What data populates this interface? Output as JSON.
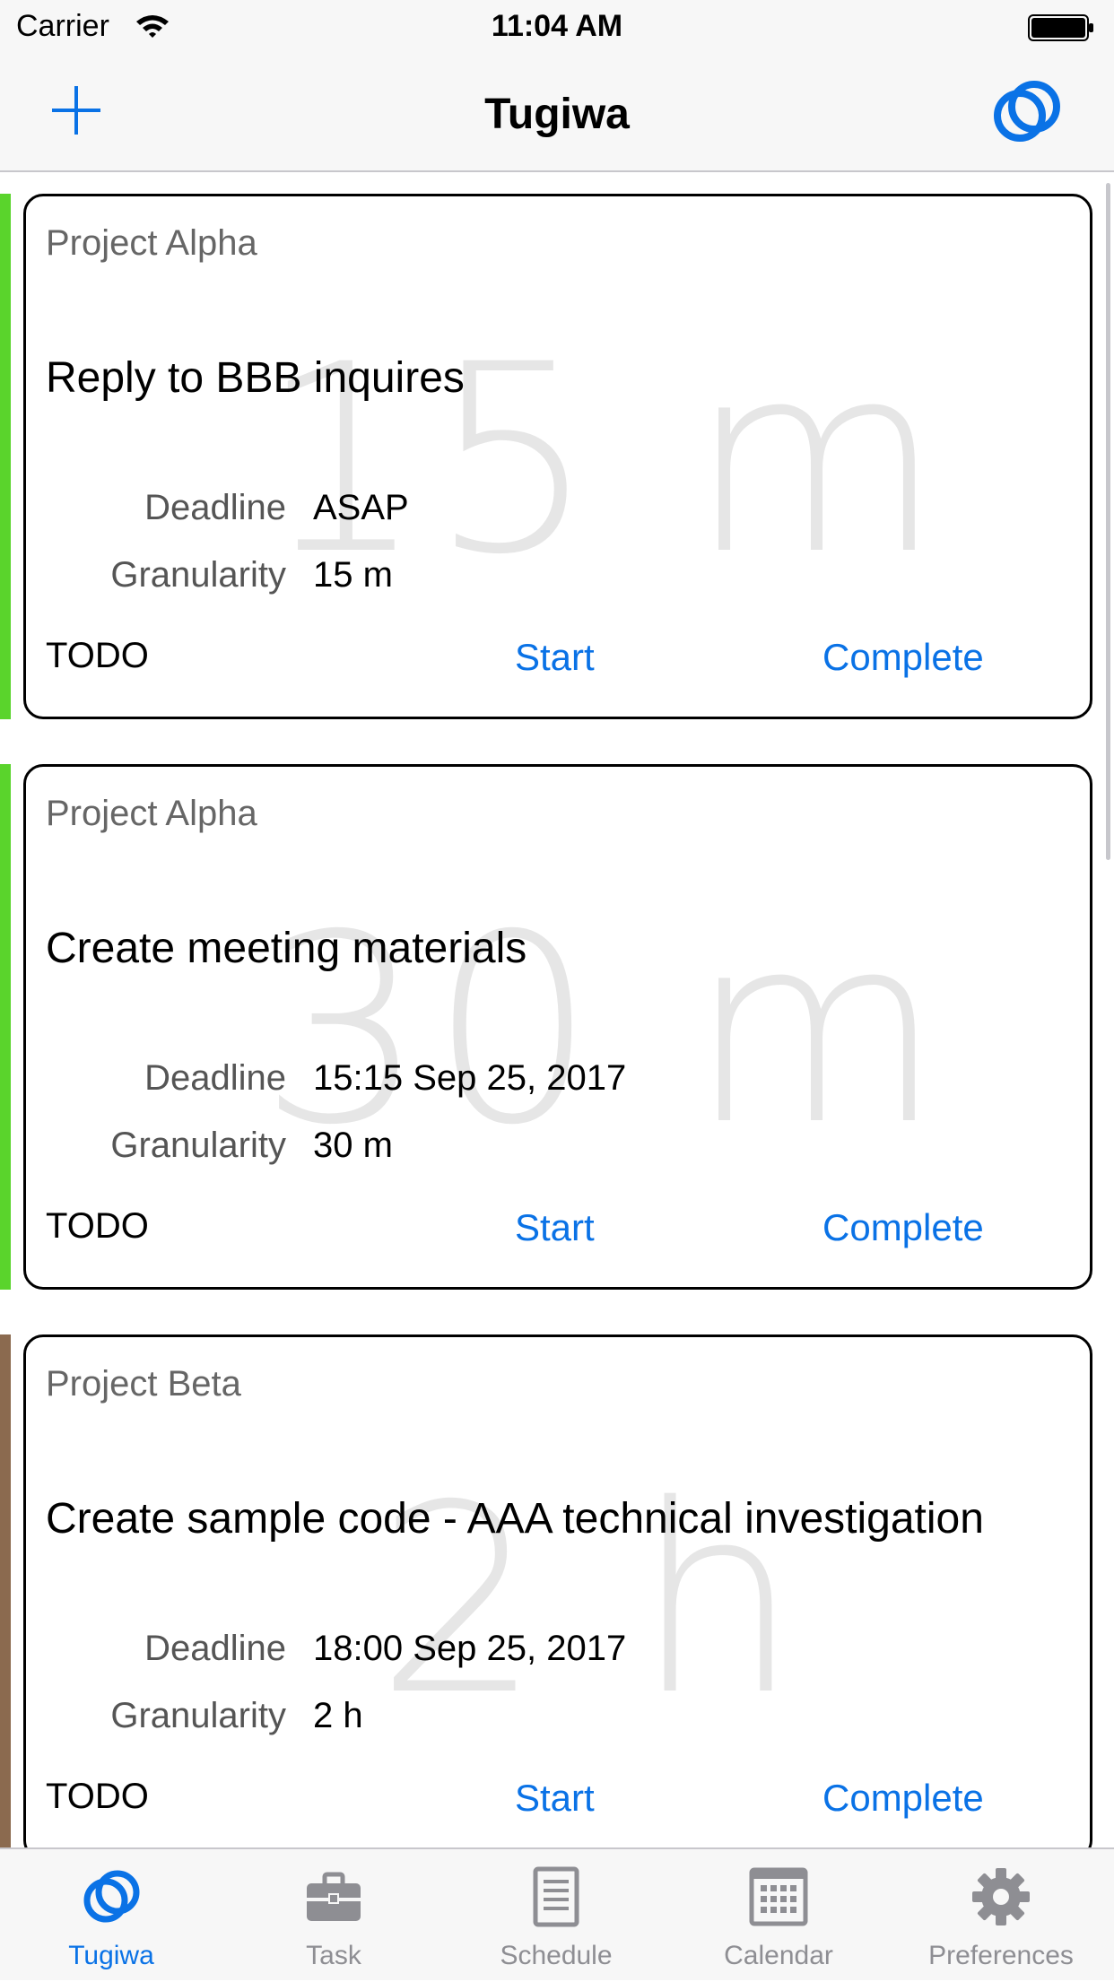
{
  "status_bar": {
    "carrier": "Carrier",
    "time": "11:04 AM"
  },
  "nav": {
    "title": "Tugiwa",
    "left_icon": "plus-icon",
    "right_icon": "rings-icon"
  },
  "colors": {
    "accent": "#0a72e6",
    "project_alpha": "#5ad42c",
    "project_beta": "#8b6a4f"
  },
  "tasks": [
    {
      "project": "Project Alpha",
      "title": "Reply to BBB inquires",
      "duration_watermark": "15 m",
      "deadline_label": "Deadline",
      "deadline": "ASAP",
      "granularity_label": "Granularity",
      "granularity": "15 m",
      "status": "TODO",
      "start_label": "Start",
      "complete_label": "Complete",
      "color": "#5ad42c"
    },
    {
      "project": "Project Alpha",
      "title": "Create meeting materials",
      "duration_watermark": "30 m",
      "deadline_label": "Deadline",
      "deadline": "15:15 Sep 25, 2017",
      "granularity_label": "Granularity",
      "granularity": "30 m",
      "status": "TODO",
      "start_label": "Start",
      "complete_label": "Complete",
      "color": "#5ad42c"
    },
    {
      "project": "Project Beta",
      "title": "Create sample code - AAA technical investigation",
      "duration_watermark": "2 h",
      "deadline_label": "Deadline",
      "deadline": "18:00 Sep 25, 2017",
      "granularity_label": "Granularity",
      "granularity": "2 h",
      "status": "TODO",
      "start_label": "Start",
      "complete_label": "Complete",
      "color": "#8b6a4f"
    }
  ],
  "tabs": [
    {
      "label": "Tugiwa",
      "icon": "rings-icon",
      "active": true
    },
    {
      "label": "Task",
      "icon": "briefcase-icon",
      "active": false
    },
    {
      "label": "Schedule",
      "icon": "document-icon",
      "active": false
    },
    {
      "label": "Calendar",
      "icon": "calendar-grid-icon",
      "active": false
    },
    {
      "label": "Preferences",
      "icon": "gear-icon",
      "active": false
    }
  ]
}
